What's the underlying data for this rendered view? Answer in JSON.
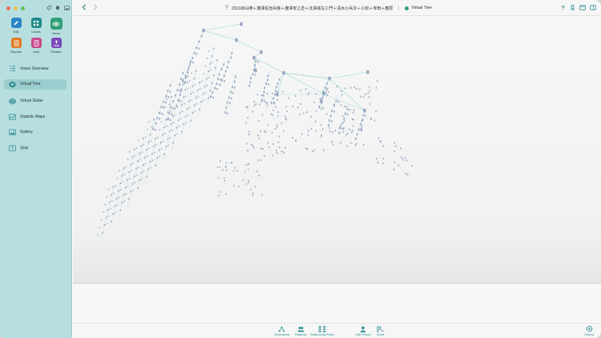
{
  "window": {
    "title": "231108山崎＋瀧澤佐治兵衛＋瀧澤安之丞＋北澤孫左エ門＋清水小兵次＋小松＋寺田＋春原",
    "view_name": "Virtual Tree"
  },
  "sidebar": {
    "apps": [
      {
        "id": "edit",
        "label": "Edit",
        "icon": "pencil-icon",
        "color": "#2b86c5"
      },
      {
        "id": "charts",
        "label": "Charts",
        "icon": "charts-grid-icon",
        "color": "#1f8a8a"
      },
      {
        "id": "views",
        "label": "Views",
        "icon": "eye-icon",
        "color": "#2e9e76",
        "active": true
      },
      {
        "id": "reports",
        "label": "Reports",
        "icon": "report-icon",
        "color": "#e07b22"
      },
      {
        "id": "lists",
        "label": "Lists",
        "icon": "list-icon",
        "color": "#c84a8c"
      },
      {
        "id": "publish",
        "label": "Publish",
        "icon": "publish-icon",
        "color": "#7a49b8"
      }
    ],
    "nav_items": [
      {
        "label": "Views Overview",
        "icon": "views-overview-icon",
        "selected": false
      },
      {
        "label": "Virtual Tree",
        "icon": "virtual-tree-icon",
        "selected": true
      },
      {
        "label": "Virtual Globe",
        "icon": "globe-icon",
        "selected": false
      },
      {
        "label": "Statistic Maps",
        "icon": "statistic-maps-icon",
        "selected": false
      },
      {
        "label": "Gallery",
        "icon": "gallery-icon",
        "selected": false
      },
      {
        "label": "Quiz",
        "icon": "quiz-icon",
        "selected": false
      }
    ]
  },
  "toolbar_right": [
    "help-icon",
    "bookmark-icon",
    "window-icon",
    "sidebar-toggle-icon"
  ],
  "bottom_bar": {
    "items": [
      {
        "label": "Generations",
        "icon": "generations-icon"
      },
      {
        "label": "Relatives",
        "icon": "relatives-icon"
      },
      {
        "label": "Relationship Paths",
        "icon": "relationship-paths-icon"
      },
      {
        "label": "Edit Person",
        "icon": "edit-person-icon"
      },
      {
        "label": "Views",
        "icon": "views-icon"
      }
    ],
    "options_label": "Options"
  },
  "colors": {
    "sidebar_bg": "#b8dfe0",
    "accent": "#2e8e92",
    "selection": "#9ccdce",
    "edge": "#7fcfc9",
    "node": "#8894b8"
  }
}
